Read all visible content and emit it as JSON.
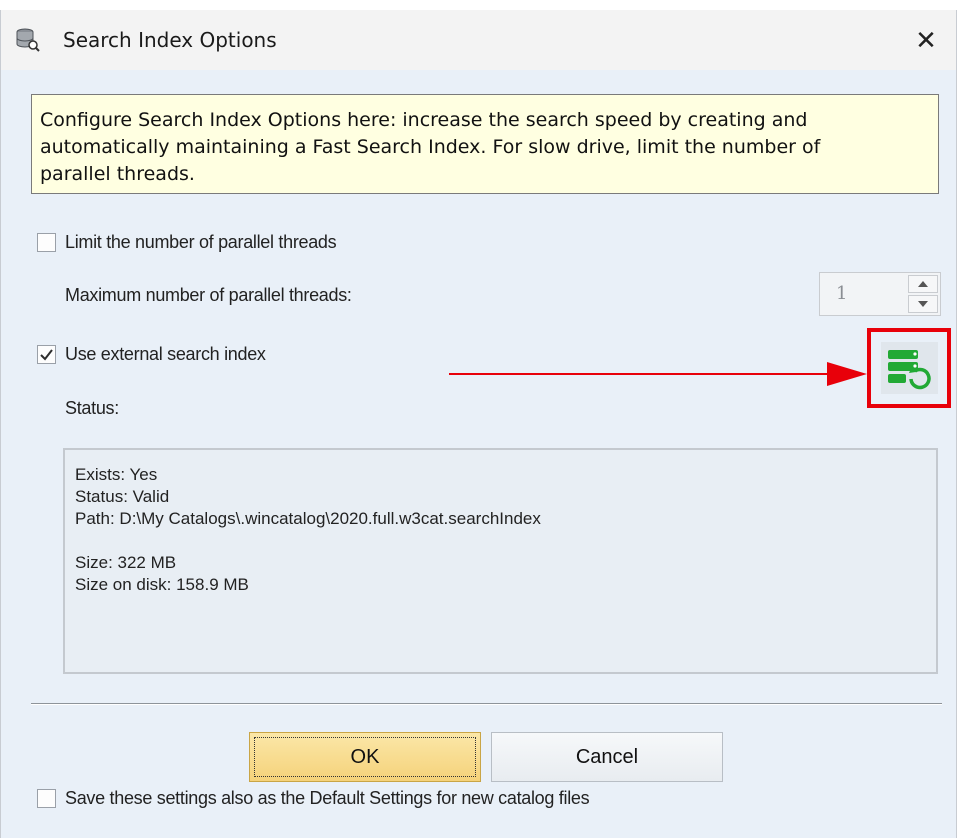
{
  "window": {
    "title": "Search Index Options",
    "close_glyph": "✕",
    "icon": "database-search-icon"
  },
  "info": {
    "line1": "Configure Search Index Options here: increase the search speed by creating and",
    "line2": "automatically maintaining a Fast Search Index. For slow drive, limit the number of",
    "line3": "parallel threads."
  },
  "options": {
    "limit_threads": {
      "label": "Limit the number of parallel threads",
      "checked": false
    },
    "max_threads_label": "Maximum number of parallel threads:",
    "max_threads_value": "1",
    "external_index": {
      "label": "Use external search index",
      "checked": true
    },
    "rebuild_icon": "rebuild-index-icon"
  },
  "status": {
    "label": "Status:",
    "lines": [
      "Exists: Yes",
      "Status: Valid",
      "Path: D:\\My Catalogs\\.wincatalog\\2020.full.w3cat.searchIndex",
      "",
      "Size: 322 MB",
      "Size on disk: 158.9 MB"
    ]
  },
  "buttons": {
    "ok": "OK",
    "cancel": "Cancel"
  },
  "save_default": {
    "label": "Save these settings also as the Default Settings for new catalog files",
    "checked": false
  },
  "colors": {
    "annotation": "#e8000a",
    "info_bg": "#ffffe1",
    "dialog_bg": "#e9f0f8",
    "icon_green": "#22a935"
  }
}
